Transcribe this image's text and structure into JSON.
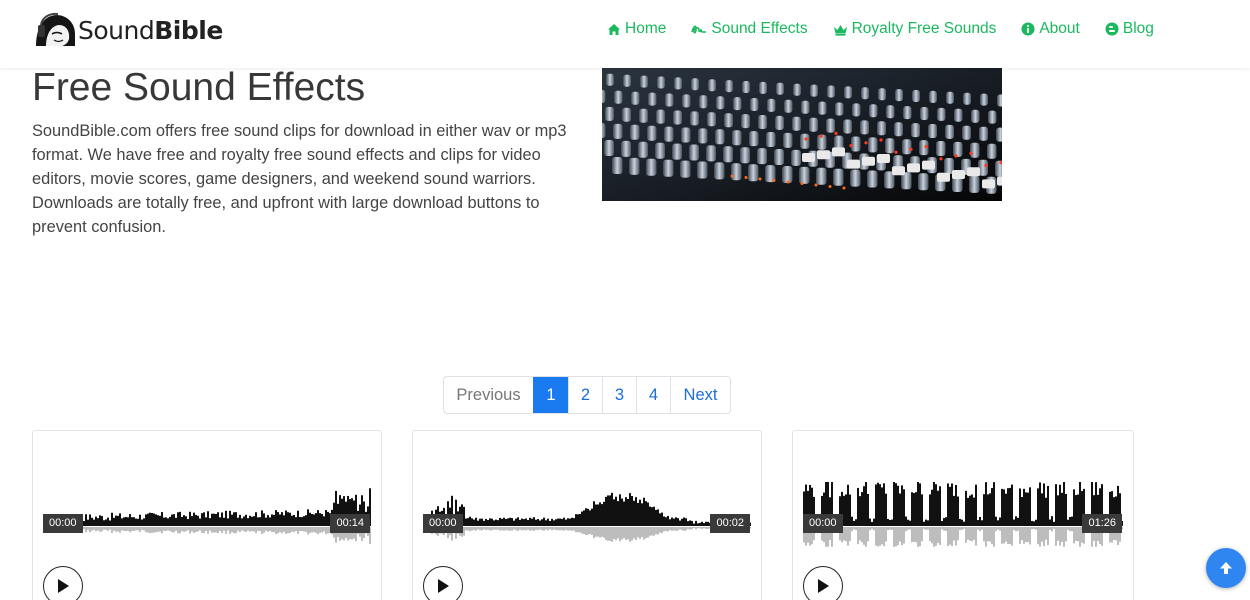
{
  "header": {
    "brand": {
      "regular": "Sound",
      "bold": "Bible"
    },
    "nav": [
      {
        "label": "Home",
        "icon": "home-icon"
      },
      {
        "label": "Sound Effects",
        "icon": "signature-icon"
      },
      {
        "label": "Royalty Free Sounds",
        "icon": "crown-icon"
      },
      {
        "label": "About",
        "icon": "info-circle-icon"
      },
      {
        "label": "Blog",
        "icon": "blogger-icon"
      }
    ]
  },
  "hero": {
    "title": "Free Sound Effects",
    "description": "SoundBible.com offers free sound clips for download in either wav or mp3 format. We have free and royalty free sound effects and clips for video editors, movie scores, game designers, and weekend sound warriors. Downloads are totally free, and upfront with large download buttons to prevent confusion."
  },
  "pagination": {
    "previous": "Previous",
    "pages": [
      "1",
      "2",
      "3",
      "4"
    ],
    "next": "Next",
    "current": "1"
  },
  "cards": [
    {
      "start_time": "00:00",
      "end_time": "00:14"
    },
    {
      "start_time": "00:00",
      "end_time": "00:02"
    },
    {
      "start_time": "00:00",
      "end_time": "01:26"
    }
  ],
  "colors": {
    "nav_green": "#1bb85f",
    "link_blue": "#1a6fd8",
    "active_blue": "#1a7bf0",
    "waveform": "#111111",
    "waveform_reflection": "#bdbdbd"
  },
  "icons": {
    "play": "play-icon",
    "back_to_top": "arrow-up-icon"
  }
}
